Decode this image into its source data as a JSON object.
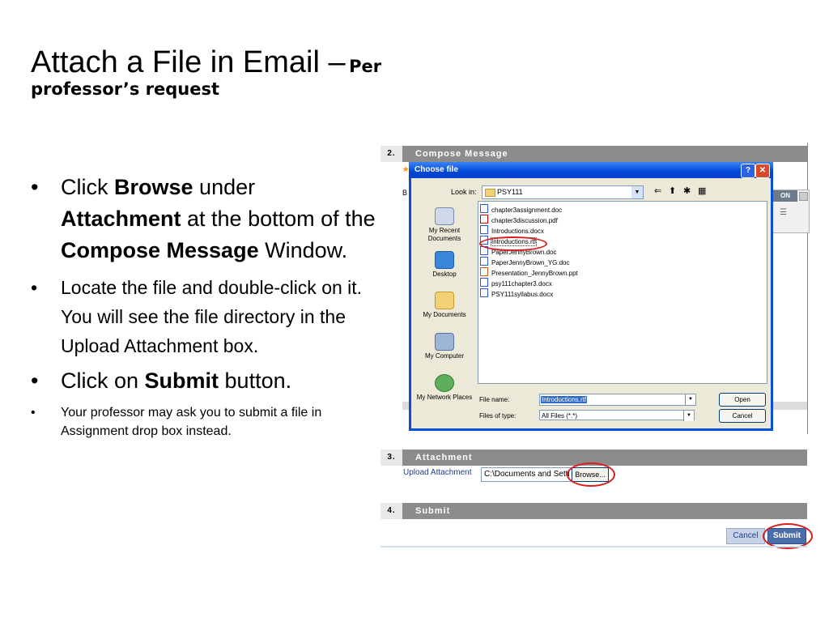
{
  "slide": {
    "title_main": "Attach a File in Email –",
    "title_sub_1": "Per",
    "title_sub_2": "professor’s request"
  },
  "bullets": [
    {
      "pre": "Click ",
      "b1": "Browse",
      "mid": " under ",
      "b2": "Attachment",
      "mid2": " at the bottom of the ",
      "b3": "Compose Message",
      "post": " Window."
    },
    {
      "text": "Locate the file and double-click on it. You will see the file directory in the Upload Attachment box."
    },
    {
      "pre": "Click on ",
      "b1": "Submit",
      "post": " button."
    },
    {
      "text": "Your professor may ask you to submit a file in Assignment drop box instead."
    }
  ],
  "bullet_char": "•",
  "form": {
    "step2_num": "2.",
    "step2_label": "Compose Message",
    "step3_num": "3.",
    "step3_label": "Attachment",
    "step4_num": "4.",
    "step4_label": "Submit",
    "upload_label": "Upload Attachment",
    "upload_value": "C:\\Documents and Setti",
    "browse_label": "Browse...",
    "cancel_label": "Cancel",
    "submit_label": "Submit",
    "bg_on": "ON",
    "bg_b": "B"
  },
  "dialog": {
    "title": "Choose file",
    "help": "?",
    "close": "✕",
    "look_in_label": "Look in:",
    "look_in_value": "PSY111",
    "places": [
      "My Recent Documents",
      "Desktop",
      "My Documents",
      "My Computer",
      "My Network Places"
    ],
    "files": [
      {
        "name": "chapter3assignment.doc",
        "type": "doc"
      },
      {
        "name": "chapter3discussion.pdf",
        "type": "pdf"
      },
      {
        "name": "Introductions.docx",
        "type": "doc"
      },
      {
        "name": "Introductions.rtf",
        "type": "doc"
      },
      {
        "name": "PaperJennyBrown.doc",
        "type": "doc"
      },
      {
        "name": "PaperJennyBrown_YG.doc",
        "type": "doc"
      },
      {
        "name": "Presentation_JennyBrown.ppt",
        "type": "ppt"
      },
      {
        "name": "psy111chapter3.docx",
        "type": "doc"
      },
      {
        "name": "PSY111syllabus.docx",
        "type": "doc"
      }
    ],
    "file_name_label": "File name:",
    "file_name_value": "Introductions.rtf",
    "file_type_label": "Files of type:",
    "file_type_value": "All Files (*.*)",
    "open_label": "Open",
    "cancel_label": "Cancel"
  },
  "colors": {
    "accent_band": "#8c8c8c",
    "dialog_blue": "#0a4fd8",
    "highlight_circle": "#d91e1e"
  }
}
